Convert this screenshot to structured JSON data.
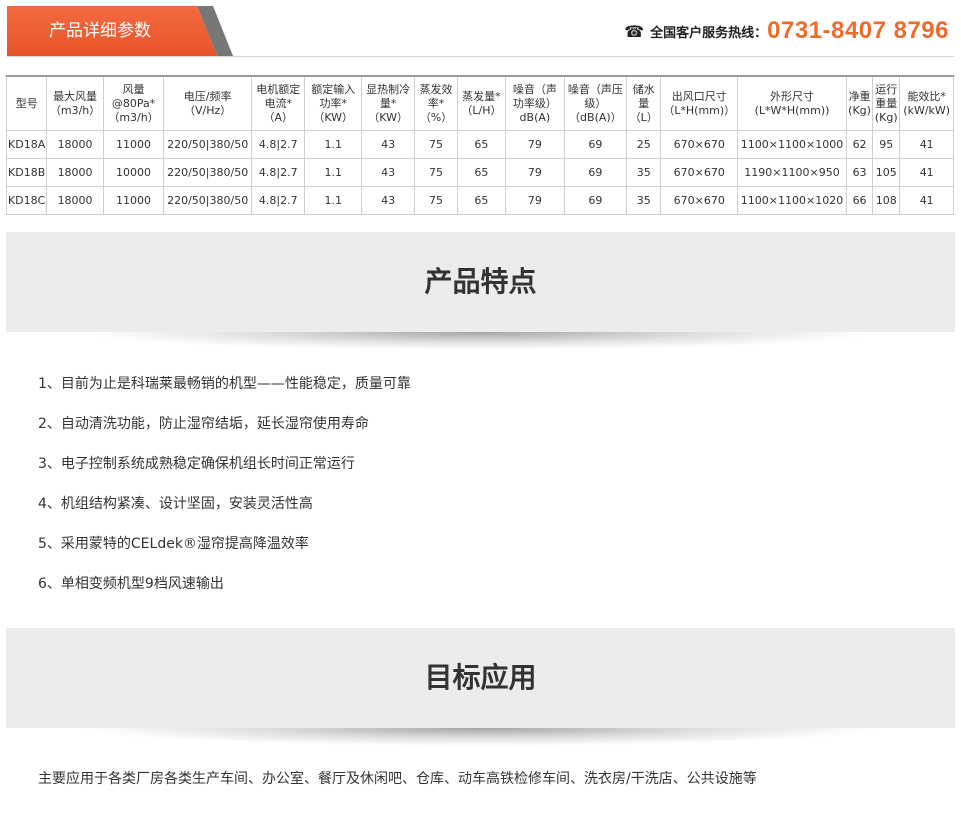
{
  "header": {
    "title": "产品详细参数",
    "phone_icon": "☎",
    "hotline_label": "全国客户服务热线：",
    "hotline_number": "0731-8407 8796",
    "accent_color": "#f06a2c"
  },
  "table": {
    "headers": [
      "型号",
      "最大风量\n（m3/h）",
      "风量\n@80Pa*\n（m3/h）",
      "电压/频率\n（V/Hz）",
      "电机额定\n电流*\n（A）",
      "额定输入\n功率*\n（KW）",
      "显热制冷\n量*\n（KW）",
      "蒸发效\n率*\n（%）",
      "蒸发量*\n（L/H）",
      "噪音（声\n功率级）\ndB(A)",
      "噪音（声压\n级）\n（dB(A)）",
      "储水\n量\n（L）",
      "出风口尺寸\n（L*H(mm)）",
      "外形尺寸\n(L*W*H(mm))",
      "净重\n(Kg)",
      "运行\n重量\n(Kg)",
      "能效比*\n(kW/kW)"
    ],
    "rows": [
      [
        "KD18A",
        "18000",
        "11000",
        "220/50|380/50",
        "4.8|2.7",
        "1.1",
        "43",
        "75",
        "65",
        "79",
        "69",
        "25",
        "670×670",
        "1100×1100×1000",
        "62",
        "95",
        "41"
      ],
      [
        "KD18B",
        "18000",
        "10000",
        "220/50|380/50",
        "4.8|2.7",
        "1.1",
        "43",
        "75",
        "65",
        "79",
        "69",
        "35",
        "670×670",
        "1190×1100×950",
        "63",
        "105",
        "41"
      ],
      [
        "KD18C",
        "18000",
        "11000",
        "220/50|380/50",
        "4.8|2.7",
        "1.1",
        "43",
        "75",
        "65",
        "79",
        "69",
        "35",
        "670×670",
        "1100×1100×1020",
        "66",
        "108",
        "41"
      ]
    ]
  },
  "features_section": {
    "title": "产品特点",
    "items": [
      "1、目前为止是科瑞莱最畅销的机型——性能稳定，质量可靠",
      "2、自动清洗功能，防止湿帘结垢，延长湿帘使用寿命",
      "3、电子控制系统成熟稳定确保机组长时间正常运行",
      "4、机组结构紧凑、设计坚固，安装灵活性高",
      "5、采用蒙特的CELdek®湿帘提高降温效率",
      "6、单相变频机型9档风速输出"
    ]
  },
  "application_section": {
    "title": "目标应用",
    "text": "主要应用于各类厂房各类生产车间、办公室、餐厅及休闲吧、仓库、动车高铁检修车间、洗衣房/干洗店、公共设施等"
  }
}
